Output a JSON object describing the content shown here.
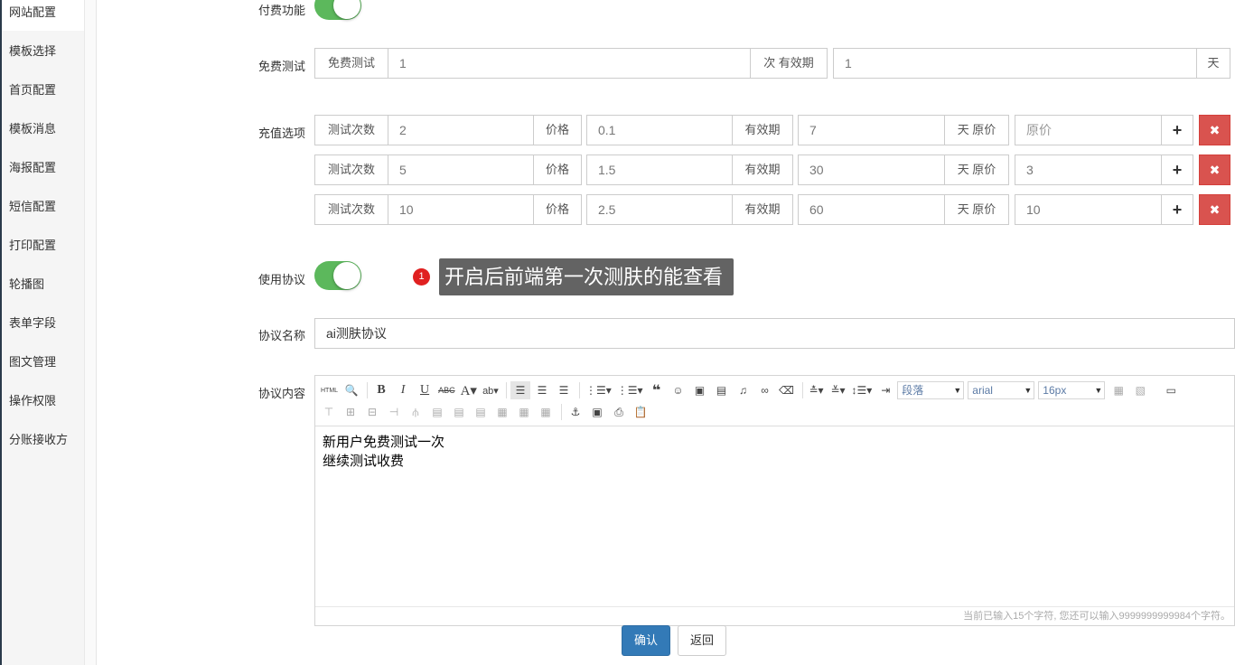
{
  "sidebar": {
    "items": [
      {
        "label": "网站配置"
      },
      {
        "label": "模板选择"
      },
      {
        "label": "首页配置"
      },
      {
        "label": "模板消息"
      },
      {
        "label": "海报配置"
      },
      {
        "label": "短信配置"
      },
      {
        "label": "打印配置"
      },
      {
        "label": "轮播图"
      },
      {
        "label": "表单字段"
      },
      {
        "label": "图文管理"
      },
      {
        "label": "操作权限"
      },
      {
        "label": "分账接收方"
      }
    ]
  },
  "form": {
    "paid_feature": {
      "label": "付费功能",
      "enabled": true
    },
    "free_test": {
      "label": "免费测试",
      "addon_prefix": "免费测试",
      "count": "1",
      "addon_mid": "次 有效期",
      "validity": "1",
      "addon_suffix": "天"
    },
    "recharge": {
      "label": "充值选项",
      "count_label": "测试次数",
      "price_label": "价格",
      "validity_label": "有效期",
      "orig_label": "天 原价",
      "orig_placeholder": "原价",
      "add_symbol": "+",
      "del_symbol": "✖",
      "rows": [
        {
          "count": "2",
          "price": "0.1",
          "validity": "7",
          "orig": ""
        },
        {
          "count": "5",
          "price": "1.5",
          "validity": "30",
          "orig": "3"
        },
        {
          "count": "10",
          "price": "2.5",
          "validity": "60",
          "orig": "10"
        }
      ]
    },
    "agreement": {
      "label": "使用协议",
      "enabled": true
    },
    "tooltip": {
      "badge": "1",
      "text": "开启后前端第一次测肤的能查看"
    },
    "agreement_name": {
      "label": "协议名称",
      "value": "ai测肤协议"
    },
    "agreement_content": {
      "label": "协议内容",
      "lines": [
        "新用户免费测试一次",
        "继续测试收费"
      ],
      "footer": "当前已输入15个字符, 您还可以输入9999999999984个字符。",
      "paragraph_select": "段落",
      "font_select": "arial",
      "size_select": "16px",
      "html_label": "HTML"
    },
    "buttons": {
      "confirm": "确认",
      "back": "返回"
    }
  },
  "colors": {
    "toggle_on": "#5cb85c",
    "primary": "#337ab7",
    "danger": "#d9534f"
  }
}
